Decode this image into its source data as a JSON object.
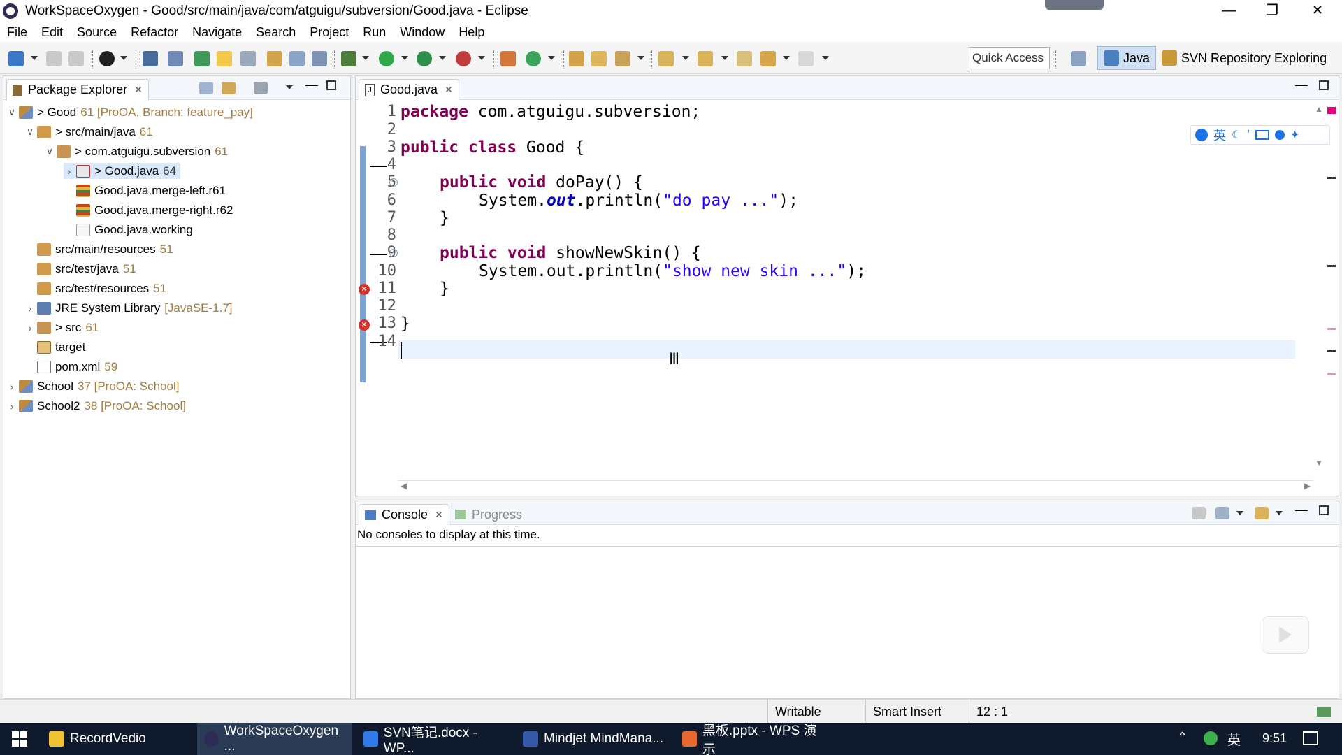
{
  "window": {
    "title": "WorkSpaceOxygen - Good/src/main/java/com/atguigu/subversion/Good.java - Eclipse"
  },
  "menu": [
    "File",
    "Edit",
    "Source",
    "Refactor",
    "Navigate",
    "Search",
    "Project",
    "Run",
    "Window",
    "Help"
  ],
  "toolbar": {
    "quick_access": "Quick Access",
    "perspectives": [
      "Java",
      "SVN Repository Exploring"
    ]
  },
  "package_explorer": {
    "title": "Package Explorer",
    "tree": [
      {
        "name": "> Good",
        "decor": "61 [ProOA, Branch: feature_pay]"
      },
      {
        "name": "> src/main/java",
        "decor": "61"
      },
      {
        "name": "> com.atguigu.subversion",
        "decor": "61"
      },
      {
        "name": "> Good.java",
        "decor": "64"
      },
      {
        "name": "Good.java.merge-left.r61",
        "decor": ""
      },
      {
        "name": "Good.java.merge-right.r62",
        "decor": ""
      },
      {
        "name": "Good.java.working",
        "decor": ""
      },
      {
        "name": "src/main/resources",
        "decor": "51"
      },
      {
        "name": "src/test/java",
        "decor": "51"
      },
      {
        "name": "src/test/resources",
        "decor": "51"
      },
      {
        "name": "JRE System Library",
        "decor": "[JavaSE-1.7]"
      },
      {
        "name": "> src",
        "decor": "61"
      },
      {
        "name": "target",
        "decor": ""
      },
      {
        "name": "pom.xml",
        "decor": "59"
      },
      {
        "name": "School",
        "decor": "37 [ProOA: School]"
      },
      {
        "name": "School2",
        "decor": "38 [ProOA: School]"
      }
    ]
  },
  "editor": {
    "tab": "Good.java",
    "line_numbers": [
      "1",
      "2",
      "3",
      "4",
      "5",
      "6",
      "7",
      "8",
      "9",
      "10",
      "11",
      "12",
      "13",
      "14"
    ],
    "lines": [
      {
        "kw": "package",
        "rest": " com.atguigu.subversion;"
      },
      {
        "kw": "",
        "rest": ""
      },
      {
        "kw": "public class",
        "rest": " Good {"
      },
      {
        "kw": "",
        "rest": ""
      },
      {
        "kw": "public void",
        "rest": " doPay() {"
      },
      {
        "pre": "System.",
        "field": "out",
        "mid": ".println(",
        "str": "\"do pay ...\"",
        "post": ");"
      },
      {
        "kw": "",
        "rest": "}"
      },
      {
        "kw": "",
        "rest": ""
      },
      {
        "kw": "public void",
        "rest": " showNewSkin() {"
      },
      {
        "pre": "System.out.println(",
        "str": "\"show new skin ...\"",
        "post": ");"
      },
      {
        "kw": "",
        "rest": "}"
      },
      {
        "kw": "",
        "rest": ""
      },
      {
        "kw": "",
        "rest": "}"
      },
      {
        "kw": "",
        "rest": ""
      }
    ]
  },
  "console": {
    "tabs": [
      "Console",
      "Progress"
    ],
    "message": "No consoles to display at this time."
  },
  "statusbar": {
    "mode": "Writable",
    "insert": "Smart Insert",
    "position": "12 : 1"
  },
  "taskbar": {
    "items": [
      "RecordVedio",
      "WorkSpaceOxygen ...",
      "SVN笔记.docx - WP...",
      "Mindjet MindMana...",
      "黑板.pptx - WPS 演示"
    ],
    "ime": "英",
    "clock": "9:51"
  },
  "ime_toolbar": {
    "lang": "英"
  }
}
